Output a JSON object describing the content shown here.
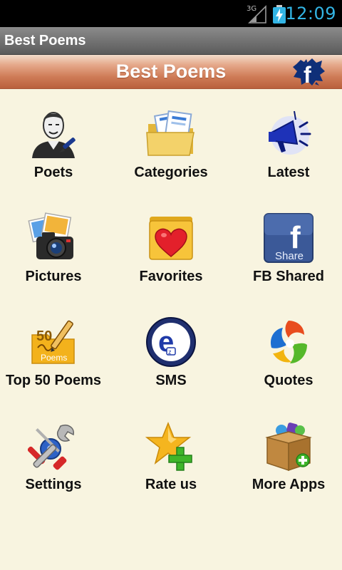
{
  "status_bar": {
    "network_label": "3G",
    "time": "12:09",
    "accent_color": "#33b5e5"
  },
  "app": {
    "window_title": "Best Poems",
    "banner_title": "Best Poems",
    "facebook_icon": "facebook-icon",
    "banner_color": "#cf7c57",
    "background_color": "#f8f4e0"
  },
  "menu": [
    {
      "label": "Poets",
      "icon": "poet-portrait-icon"
    },
    {
      "label": "Categories",
      "icon": "folder-documents-icon"
    },
    {
      "label": "Latest",
      "icon": "megaphone-icon"
    },
    {
      "label": "Pictures",
      "icon": "camera-photos-icon"
    },
    {
      "label": "Favorites",
      "icon": "heart-folder-icon"
    },
    {
      "label": "FB Shared",
      "icon": "facebook-share-icon",
      "icon_text": "Share"
    },
    {
      "label": "Top 50 Poems",
      "icon": "top-50-poems-icon",
      "icon_text_top": "50",
      "icon_text_bottom": "Poems"
    },
    {
      "label": "SMS",
      "icon": "sms-e-icon",
      "icon_text": "e"
    },
    {
      "label": "Quotes",
      "icon": "quotes-swirl-icon"
    },
    {
      "label": "Settings",
      "icon": "tools-wrench-screwdriver-icon"
    },
    {
      "label": "Rate us",
      "icon": "star-plus-icon"
    },
    {
      "label": "More Apps",
      "icon": "app-box-icon"
    }
  ]
}
